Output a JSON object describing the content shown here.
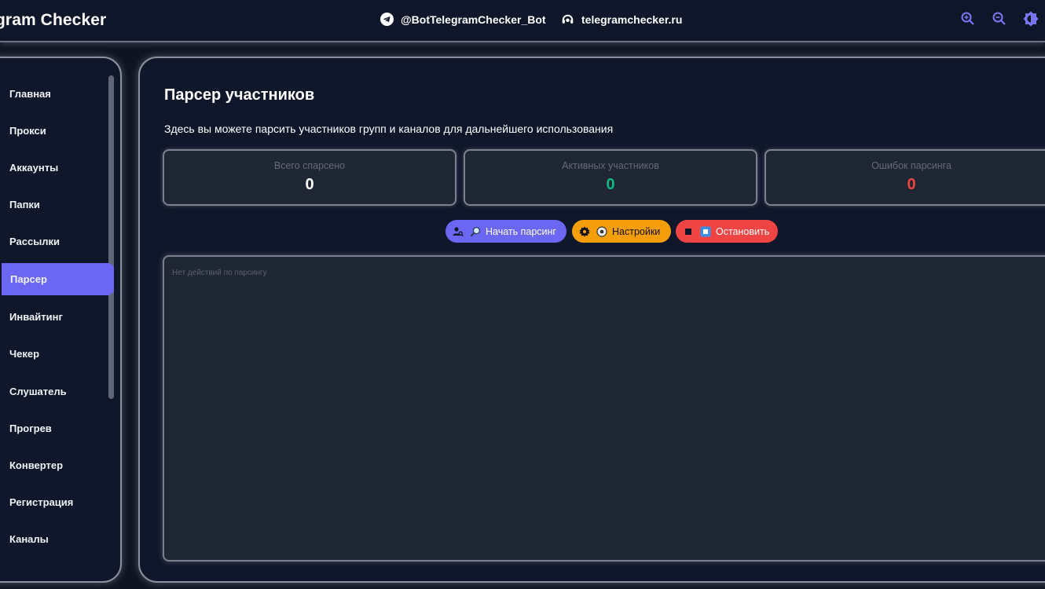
{
  "header": {
    "title": "gram Checker",
    "bot_link": "@BotTelegramChecker_Bot",
    "site_link": "telegramchecker.ru",
    "icons": [
      "zoom-in-icon",
      "zoom-out-icon",
      "theme-toggle-icon"
    ]
  },
  "sidebar": {
    "items": [
      {
        "label": "Главная"
      },
      {
        "label": "Прокси"
      },
      {
        "label": "Аккаунты"
      },
      {
        "label": "Папки"
      },
      {
        "label": "Рассылки"
      },
      {
        "label": "Парсер",
        "active": true
      },
      {
        "label": "Инвайтинг"
      },
      {
        "label": "Чекер"
      },
      {
        "label": "Слушатель"
      },
      {
        "label": "Прогрев"
      },
      {
        "label": "Конвертер"
      },
      {
        "label": "Регистрация"
      },
      {
        "label": "Каналы"
      }
    ]
  },
  "main": {
    "title": "Парсер участников",
    "description": "Здесь вы можете парсить участников групп и каналов для дальнейшего использования",
    "stats": [
      {
        "label": "Всего спарсено",
        "value": "0",
        "color": "#ffffff"
      },
      {
        "label": "Активных участников",
        "value": "0",
        "color": "#10b981"
      },
      {
        "label": "Ошибок парсинга",
        "value": "0",
        "color": "#ef4444"
      }
    ],
    "buttons": {
      "start": "Начать парсинг",
      "settings": "Настройки",
      "stop": "Остановить"
    },
    "log_placeholder": "Нет действий по парсингу"
  },
  "colors": {
    "accent": "#6b67f2",
    "warning": "#f59e0b",
    "danger": "#ef4444",
    "success": "#10b981",
    "background": "#10172a"
  }
}
